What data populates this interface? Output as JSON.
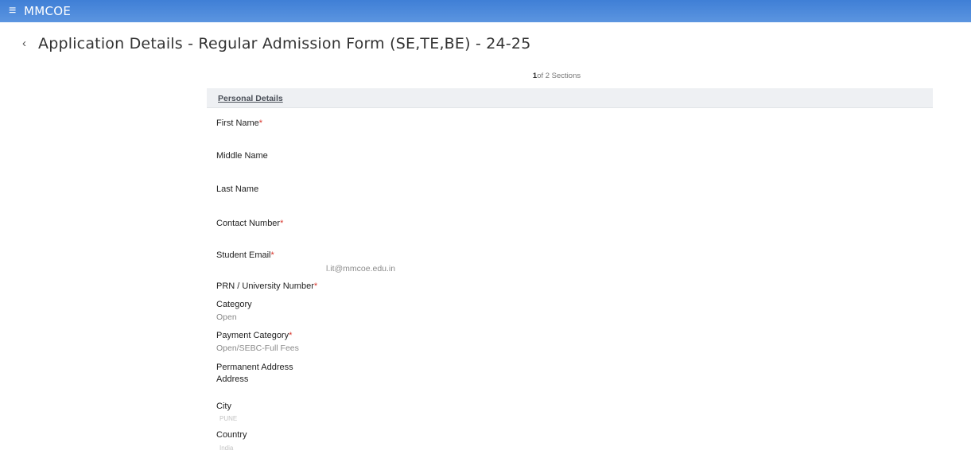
{
  "header": {
    "menu_icon": "≡",
    "app_name": "MMCOE"
  },
  "page": {
    "back_icon": "‹",
    "title": "Application Details - Regular Admission Form (SE,TE,BE) - 24-25"
  },
  "progress": {
    "current": "1",
    "rest": "of 2 Sections"
  },
  "section": {
    "title": "Personal Details"
  },
  "required_mark": "*",
  "fields": {
    "first_name": {
      "label": "First Name",
      "value": ""
    },
    "middle_name": {
      "label": "Middle Name",
      "value": ""
    },
    "last_name": {
      "label": "Last Name",
      "value": ""
    },
    "contact_number": {
      "label": "Contact Number",
      "value": ""
    },
    "student_email": {
      "label": "Student Email",
      "value": "l.it@mmcoe.edu.in"
    },
    "prn": {
      "label": "PRN / University Number",
      "value": ""
    },
    "category": {
      "label": "Category",
      "value": "Open"
    },
    "payment_category": {
      "label": "Payment Category",
      "value": "Open/SEBC-Full Fees"
    },
    "permanent_address": {
      "label": "Permanent Address"
    },
    "address": {
      "label": "Address",
      "value": ""
    },
    "city": {
      "label": "City",
      "value": "PUNE"
    },
    "country": {
      "label": "Country",
      "value": "India"
    }
  },
  "colors": {
    "header_bg": "#4a88dc",
    "required": "#d8342b",
    "section_bg": "#eef0f3"
  }
}
